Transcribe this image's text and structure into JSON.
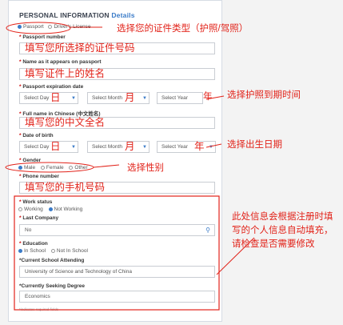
{
  "form": {
    "title": "PERSONAL INFORMATION",
    "title_link": "Details",
    "id_options": [
      "Passport",
      "Driver's License"
    ],
    "passport_label": "Passport number",
    "passport_fill": "填写您所选择的证件号码",
    "name_label": "Name as it appears on passport",
    "name_fill": "填写证件上的姓名",
    "expiry_label": "Passport expiration date",
    "select_day": "Select Day",
    "select_month": "Select Month",
    "select_year": "Select Year",
    "char_day": "日",
    "char_month": "月",
    "char_year": "年",
    "chinese_name_label": "Full name in Chinese (中文姓名)",
    "chinese_name_fill": "填写您的中文全名",
    "dob_label": "Date of birth",
    "gender_label": "Gender",
    "gender_options": [
      "Male",
      "Female",
      "Other"
    ],
    "phone_label": "Phone number",
    "phone_fill": "填写您的手机号码",
    "work_label": "Work status",
    "work_options": [
      "Working",
      "Not Working"
    ],
    "company_label": "Last Company",
    "company_value": "No",
    "education_label": "Education",
    "education_options": [
      "In School",
      "Not In School"
    ],
    "school_label": "*Current School Attending",
    "school_value": "University of Science and Technology of China",
    "degree_label": "*Currently Seeking Degree",
    "degree_value": "Economics",
    "footnote": "*indicates required fields"
  },
  "annotations": {
    "id_type": "选择您的证件类型（护照/驾照）",
    "expiry": "选择护照到期时间",
    "dob": "选择出生日期",
    "gender": "选择性别",
    "autofill": [
      "此处信息会根据注册时填",
      "写的个人信息自动填充，",
      "请检查是否需要修改"
    ]
  },
  "colors": {
    "accent": "#3a7bc8",
    "annotation": "#e2231a"
  }
}
